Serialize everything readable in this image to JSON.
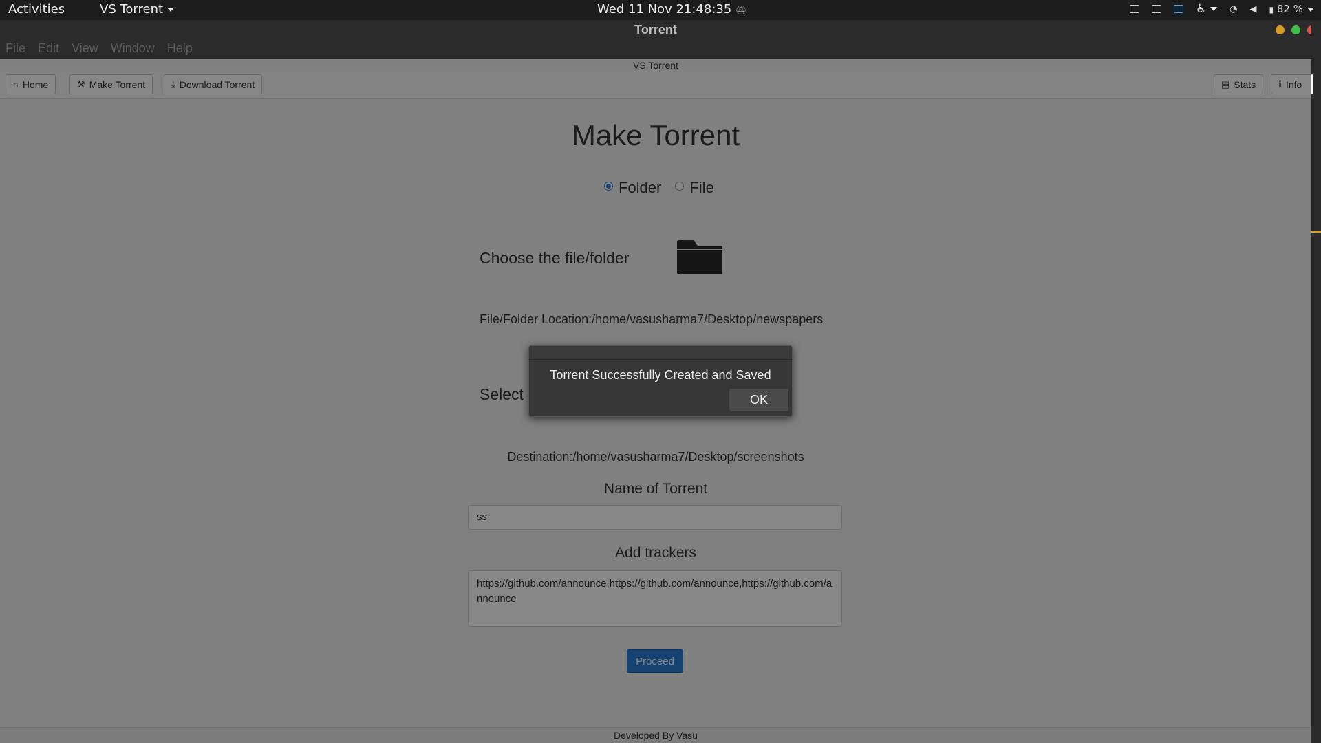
{
  "topbar": {
    "activities": "Activities",
    "app_menu": "VS Torrent",
    "clock": "Wed 11 Nov  21:48:35",
    "battery": "82 %"
  },
  "window": {
    "title": "Torrent",
    "menus": [
      "File",
      "Edit",
      "View",
      "Window",
      "Help"
    ]
  },
  "app": {
    "subtitle": "VS Torrent",
    "nav": {
      "home": "Home",
      "make": "Make Torrent",
      "download": "Download Torrent",
      "stats": "Stats",
      "info": "Info"
    },
    "heading": "Make Torrent",
    "radio_folder": "Folder",
    "radio_file": "File",
    "selected_mode": "Folder",
    "choose_label": "Choose the file/folder",
    "location": "File/Folder Location:/home/vasusharma7/Desktop/newspapers",
    "select_label": "Select",
    "destination": "Destination:/home/vasusharma7/Desktop/screenshots",
    "name_label": "Name of Torrent",
    "name_value": "ss",
    "trackers_label": "Add trackers",
    "trackers_value": "https://github.com/announce,https://github.com/announce,https://github.com/announce",
    "proceed": "Proceed",
    "footer": "Developed By Vasu"
  },
  "dialog": {
    "message": "Torrent Successfully Created and Saved",
    "ok": "OK"
  }
}
